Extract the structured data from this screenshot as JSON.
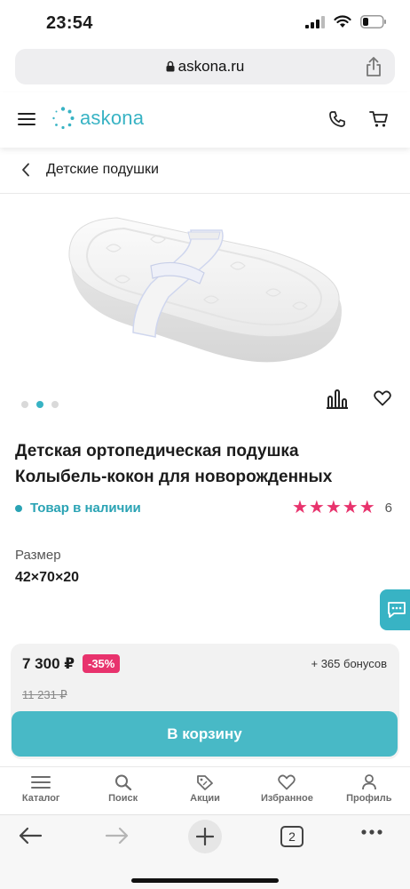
{
  "status_bar": {
    "time": "23:54"
  },
  "browser": {
    "url": "askona.ru",
    "tab_count": "2"
  },
  "header": {
    "logo_text": "askona",
    "brand_color": "#38b3c4"
  },
  "breadcrumb": {
    "label": "Детские подушки"
  },
  "gallery": {
    "slide_count": 3,
    "active_slide": 2
  },
  "product": {
    "title": "Детская ортопедическая подушка Колыбель-кокон для новорожденных",
    "stock_status": "Товар в наличии",
    "rating_stars": 5,
    "review_count": "6",
    "size_label": "Размер",
    "size_value": "42×70×20"
  },
  "pricing": {
    "price": "7 300 ₽",
    "discount": "-35%",
    "bonus": "+ 365 бонусов",
    "old_price": "11 231 ₽",
    "add_to_cart": "В корзину"
  },
  "bottom_nav": [
    {
      "label": "Каталог",
      "icon": "menu-icon"
    },
    {
      "label": "Поиск",
      "icon": "search-icon"
    },
    {
      "label": "Акции",
      "icon": "tag-icon"
    },
    {
      "label": "Избранное",
      "icon": "heart-icon"
    },
    {
      "label": "Профиль",
      "icon": "user-icon"
    }
  ],
  "colors": {
    "accent": "#38b3c4",
    "rating_star": "#e8336d",
    "discount_badge": "#e8336d"
  }
}
